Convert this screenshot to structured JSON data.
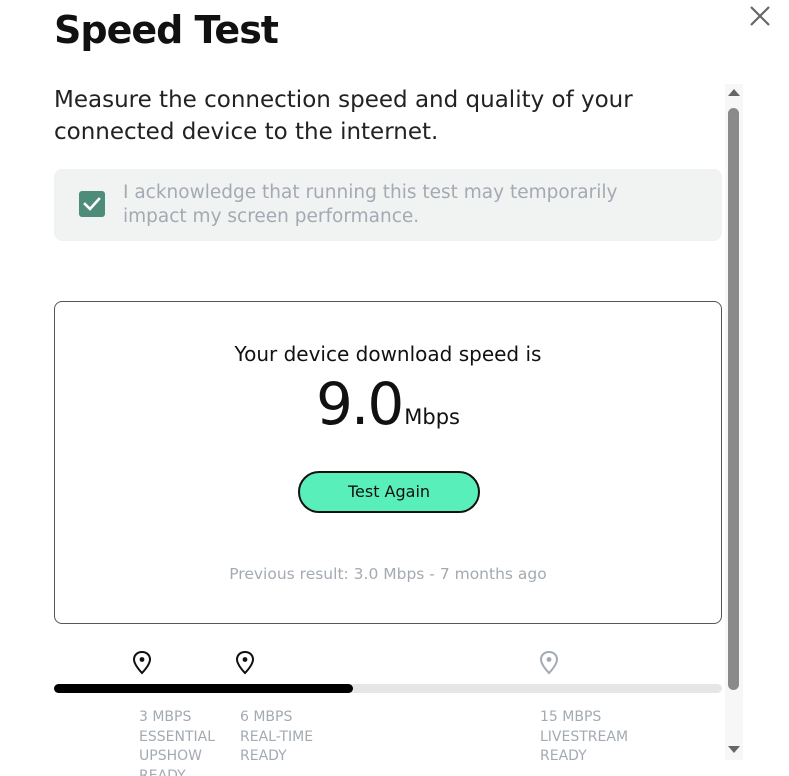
{
  "header": {
    "title": "Speed Test",
    "close_icon": "close-icon"
  },
  "intro": {
    "description": "Measure the connection speed and quality of your connected device to the internet."
  },
  "acknowledgement": {
    "checked": true,
    "text": "I acknowledge that running this test may temporarily impact my screen performance.",
    "check_color": "#4c8c79"
  },
  "result": {
    "heading": "Your device download speed is",
    "speed_value": "9.0",
    "speed_unit": "Mbps",
    "test_again_label": "Test Again",
    "previous_result": "Previous result: 3.0 Mbps - 7 months ago",
    "button_color": "#58efbb"
  },
  "progress": {
    "current_mbps": 9.0,
    "fill_fraction": 0.447,
    "fill_color": "#000000",
    "track_color": "#e4e6e8",
    "milestones": [
      {
        "mbps": 3,
        "label_lines": [
          "3 MBPS",
          "ESSENTIAL",
          "UPSHOW",
          "READY"
        ],
        "reached": true
      },
      {
        "mbps": 6,
        "label_lines": [
          "6 MBPS",
          "REAL-TIME",
          "READY"
        ],
        "reached": true
      },
      {
        "mbps": 15,
        "label_lines": [
          "15 MBPS",
          "LIVESTREAM",
          "READY"
        ],
        "reached": false
      }
    ]
  },
  "scrollbar": {
    "up_icon": "scroll-up-arrow-icon",
    "down_icon": "scroll-down-arrow-icon"
  }
}
